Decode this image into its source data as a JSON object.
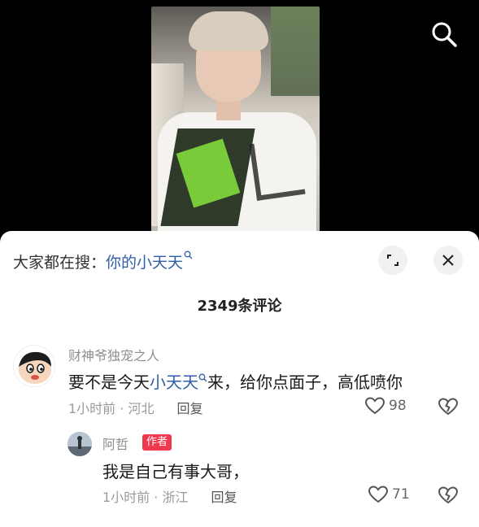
{
  "video": {
    "search_icon": "search-icon"
  },
  "panel": {
    "search_prefix": "大家都在搜：",
    "search_term": "你的小天天",
    "expand_icon": "expand-icon",
    "close_icon": "close-icon",
    "comment_count": "2349条评论"
  },
  "comments": [
    {
      "username": "财神爷独宠之人",
      "text_before": "要不是今天",
      "text_link": "小天天",
      "text_after": "来，给你点面子，高低喷你",
      "time_location": "1小时前 · 河北",
      "reply_label": "回复",
      "likes": "98"
    },
    {
      "username": "阿哲",
      "badge": "作者",
      "text": "我是自己有事大哥，",
      "time_location": "1小时前 · 浙江",
      "reply_label": "回复",
      "likes": "71"
    }
  ],
  "colors": {
    "link_blue": "#2f5fa8",
    "author_badge": "#f0394f"
  }
}
